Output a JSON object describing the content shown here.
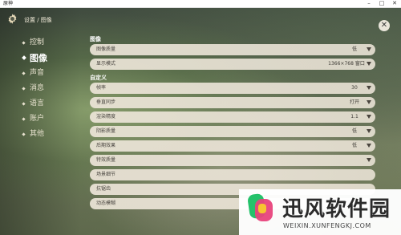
{
  "window": {
    "title": "原神",
    "controls": [
      "–",
      "□",
      "✕"
    ]
  },
  "header": {
    "breadcrumb": "设置 / 图像",
    "close": "✕"
  },
  "nav": {
    "items": [
      {
        "label": "控制",
        "active": false
      },
      {
        "label": "图像",
        "active": true
      },
      {
        "label": "声音",
        "active": false
      },
      {
        "label": "消息",
        "active": false
      },
      {
        "label": "语言",
        "active": false
      },
      {
        "label": "账户",
        "active": false
      },
      {
        "label": "其他",
        "active": false
      }
    ]
  },
  "sections": {
    "image": {
      "title": "图像",
      "rows": [
        {
          "label": "图像质量",
          "value": "低"
        },
        {
          "label": "显示模式",
          "value": "1366×768 窗口"
        }
      ]
    },
    "custom": {
      "title": "自定义",
      "rows": [
        {
          "label": "帧率",
          "value": "30"
        },
        {
          "label": "垂直同步",
          "value": "打开"
        },
        {
          "label": "渲染精度",
          "value": "1.1"
        },
        {
          "label": "阴影质量",
          "value": "低"
        },
        {
          "label": "后期效果",
          "value": "低"
        },
        {
          "label": "特效质量",
          "value": ""
        },
        {
          "label": "场景细节",
          "value": ""
        },
        {
          "label": "抗锯齿",
          "value": ""
        },
        {
          "label": "动态模糊",
          "value": ""
        }
      ]
    }
  },
  "watermark": {
    "title": "迅风软件园",
    "url": "WEIXIN.XUNFENGKJ.COM"
  },
  "colors": {
    "row_bg": "#ece5d8",
    "logo_green": "#25c26b",
    "logo_pink": "#e8437c",
    "logo_yellow": "#f7c531"
  }
}
